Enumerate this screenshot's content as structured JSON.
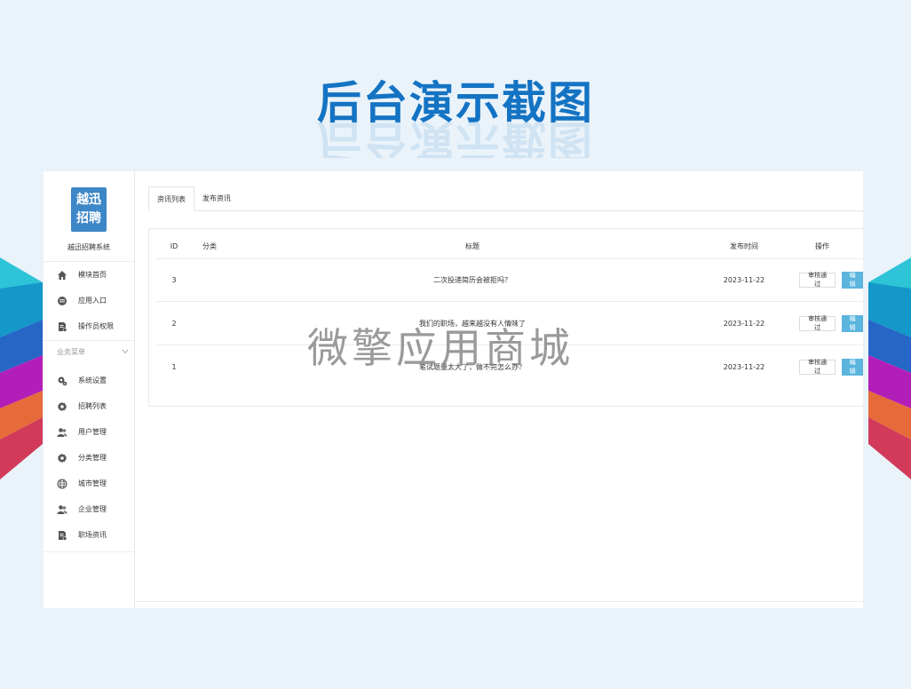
{
  "hero": {
    "title": "后台演示截图"
  },
  "watermark": "微擎应用商城",
  "sidebar": {
    "logo_line1": "越迅",
    "logo_line2": "招聘",
    "system_name": "越迅招聘系统",
    "top_items": [
      {
        "label": "模块首页",
        "icon": "home-icon"
      },
      {
        "label": "应用入口",
        "icon": "chat-icon"
      },
      {
        "label": "操作员权限",
        "icon": "document-icon"
      }
    ],
    "group_label": "业务菜单",
    "group_items": [
      {
        "label": "系统设置",
        "icon": "settings-icon"
      },
      {
        "label": "招聘列表",
        "icon": "gear-icon"
      },
      {
        "label": "用户管理",
        "icon": "users-icon"
      },
      {
        "label": "分类管理",
        "icon": "gear-icon"
      },
      {
        "label": "城市管理",
        "icon": "globe-icon"
      },
      {
        "label": "企业管理",
        "icon": "users-icon"
      },
      {
        "label": "职场资讯",
        "icon": "document-icon"
      }
    ]
  },
  "tabs": [
    {
      "label": "资讯列表",
      "active": true
    },
    {
      "label": "发布资讯",
      "active": false
    }
  ],
  "table": {
    "headers": {
      "id": "ID",
      "category": "分类",
      "title": "标题",
      "date": "发布时间",
      "action": "操作"
    },
    "rows": [
      {
        "id": "3",
        "category": "",
        "title": "二次投递简历会被拒吗？",
        "date": "2023-11-22"
      },
      {
        "id": "2",
        "category": "",
        "title": "我们的职场，越来越没有人情味了",
        "date": "2023-11-22"
      },
      {
        "id": "1",
        "category": "",
        "title": "笔试题量太大了，做不完怎么办？",
        "date": "2023-11-22"
      }
    ],
    "approve_label": "审核通过",
    "edit_label": "编辑"
  },
  "colors": {
    "accent": "#1473c3",
    "logo": "#3d87c8",
    "edit_button": "#5bb5de",
    "background": "#eaf3fa"
  }
}
